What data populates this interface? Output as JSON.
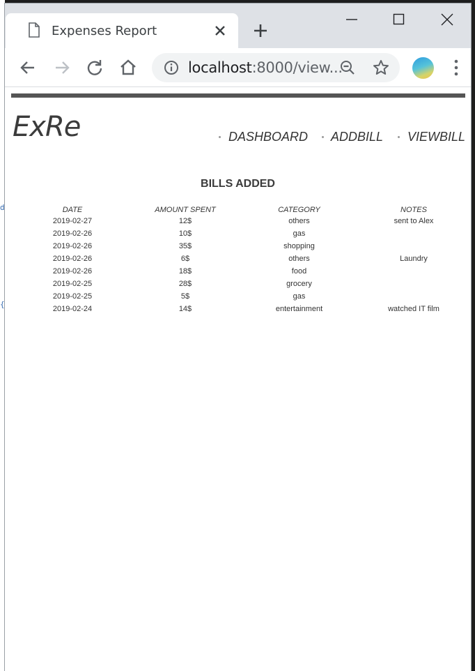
{
  "left_strip_glyphs": [
    "d",
    "{"
  ],
  "browser": {
    "tab_title": "Expenses Report",
    "url_host": "localhost",
    "url_rest": ":8000/view..."
  },
  "site": {
    "logo": "ExRe",
    "nav": [
      "DASHBOARD",
      "ADDBILL",
      "VIEWBILL"
    ]
  },
  "bills": {
    "title": "BILLS ADDED",
    "columns": [
      "DATE",
      "AMOUNT SPENT",
      "CATEGORY",
      "NOTES"
    ],
    "rows": [
      {
        "date": "2019-02-27",
        "amount": "12$",
        "category": "others",
        "notes": "sent to Alex"
      },
      {
        "date": "2019-02-26",
        "amount": "10$",
        "category": "gas",
        "notes": ""
      },
      {
        "date": "2019-02-26",
        "amount": "35$",
        "category": "shopping",
        "notes": ""
      },
      {
        "date": "2019-02-26",
        "amount": "6$",
        "category": "others",
        "notes": "Laundry"
      },
      {
        "date": "2019-02-26",
        "amount": "18$",
        "category": "food",
        "notes": ""
      },
      {
        "date": "2019-02-25",
        "amount": "28$",
        "category": "grocery",
        "notes": ""
      },
      {
        "date": "2019-02-25",
        "amount": "5$",
        "category": "gas",
        "notes": ""
      },
      {
        "date": "2019-02-24",
        "amount": "14$",
        "category": "entertainment",
        "notes": "watched IT film"
      }
    ]
  }
}
